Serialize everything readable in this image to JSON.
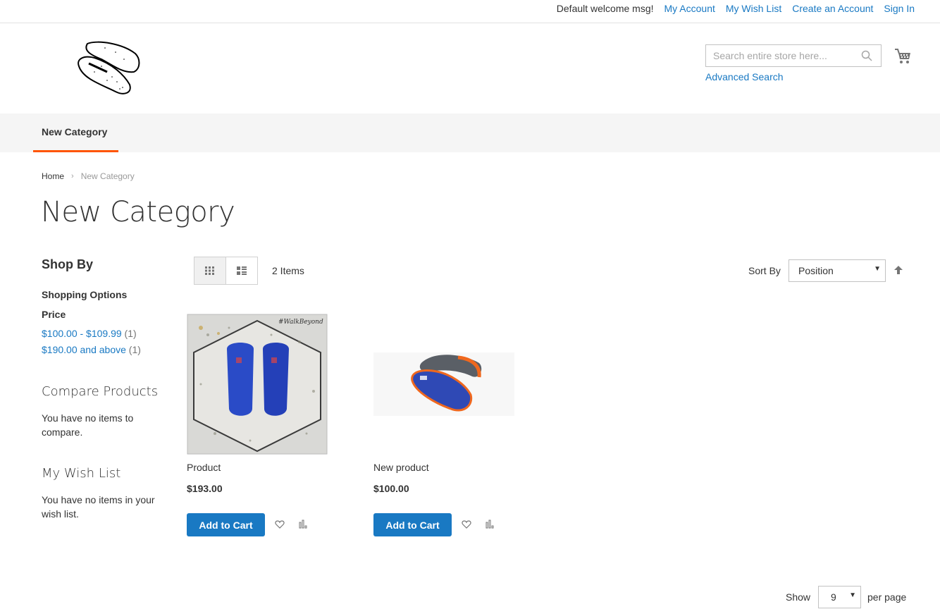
{
  "topbar": {
    "welcome": "Default welcome msg!",
    "links": [
      "My Account",
      "My Wish List",
      "Create an Account",
      "Sign In"
    ]
  },
  "header": {
    "logo_alt": "insoles-logo",
    "search_placeholder": "Search entire store here...",
    "advanced_search": "Advanced Search",
    "cart_icon": "shopping-cart-icon"
  },
  "nav": {
    "items": [
      "New Category"
    ],
    "active_color": "#ff5501"
  },
  "breadcrumbs": {
    "home": "Home",
    "separator": "›",
    "current": "New Category"
  },
  "page_title": "New Category",
  "sidebar": {
    "shop_by": "Shop By",
    "shopping_options": "Shopping Options",
    "price_label": "Price",
    "filters": [
      {
        "label": "$100.00 - $109.99",
        "count": "(1)"
      },
      {
        "label": "$190.00 and above",
        "count": "(1)"
      }
    ],
    "compare_title": "Compare Products",
    "compare_text": "You have no items to compare.",
    "wishlist_title": "My Wish List",
    "wishlist_text": "You have no items in your wish list."
  },
  "toolbar": {
    "items_count": "2 Items",
    "sort_label": "Sort By",
    "sort_value": "Position",
    "show_label": "Show",
    "limit_value": "9",
    "per_page": "per page"
  },
  "products": [
    {
      "name": "Product",
      "price": "$193.00",
      "add_to_cart": "Add to Cart",
      "image_caption": "#WalkBeyond"
    },
    {
      "name": "New product",
      "price": "$100.00",
      "add_to_cart": "Add to Cart"
    }
  ],
  "colors": {
    "link": "#1979c3",
    "button": "#1979c3",
    "nav_bg": "#f5f5f5",
    "accent": "#ff5501"
  }
}
